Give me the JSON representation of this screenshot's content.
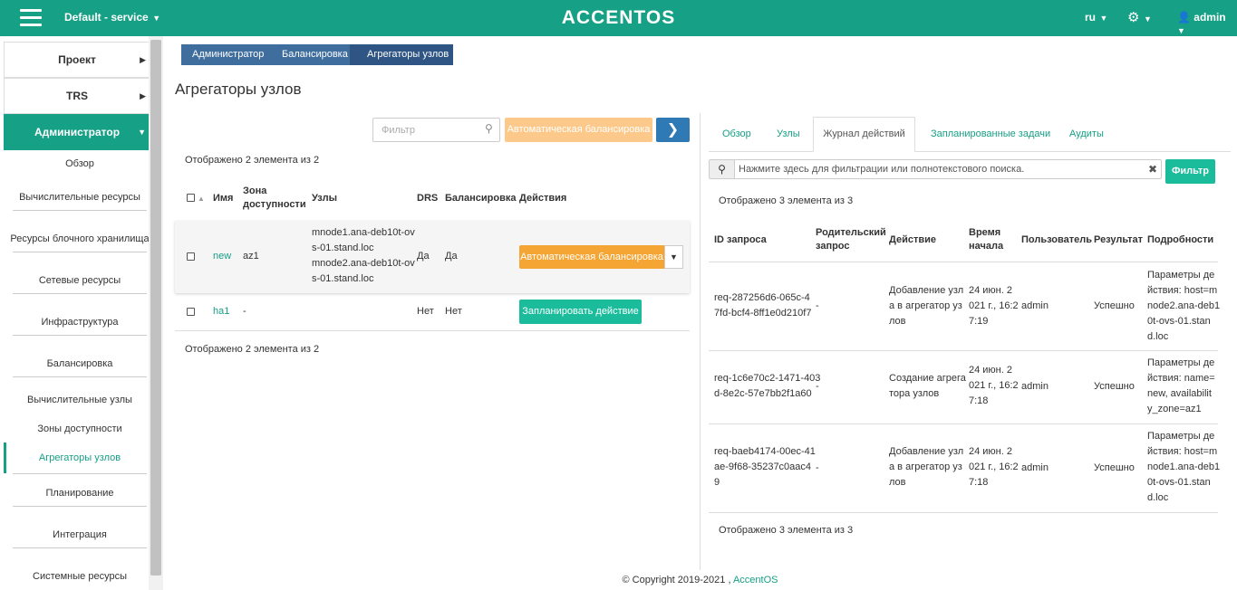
{
  "topbar": {
    "project": "Default - service",
    "logo": "ACCENTOS",
    "lang": "ru",
    "user": "admin",
    "bg": "#16a085"
  },
  "sidebar": {
    "top": [
      {
        "label": "Проект"
      },
      {
        "label": "TRS"
      },
      {
        "label": "Администратор"
      }
    ],
    "items": [
      "Обзор",
      "Вычислительные ресурсы",
      "Ресурсы блочного хранилища",
      "Сетевые ресурсы",
      "Инфраструктура",
      "Балансировка",
      "Вычислительные узлы",
      "Зоны доступности",
      "Агрегаторы узлов",
      "Планирование",
      "Интеграция",
      "Системные ресурсы"
    ]
  },
  "breadcrumb": [
    "Администратор",
    "Балансировка",
    "Агрегаторы узлов"
  ],
  "page_title": "Агрегаторы узлов",
  "left": {
    "filter_placeholder": "Фильтр",
    "auto_btn": "Автоматическая балансировка",
    "count": "Отображено 2 элемента из 2",
    "headers": {
      "name": "Имя",
      "zone_1": "Зона",
      "zone_2": "доступности",
      "nodes": "Узлы",
      "drs": "DRS",
      "balance": "Балансировка",
      "actions": "Действия"
    },
    "rows": [
      {
        "name": "new",
        "zone": "az1",
        "nodes": [
          "mnode1.ana-deb10t-ov",
          "s-01.stand.loc",
          "mnode2.ana-deb10t-ov",
          "s-01.stand.loc"
        ],
        "drs": "Да",
        "balance": "Да",
        "action": "Автоматическая балансировка"
      },
      {
        "name": "ha1",
        "zone": "-",
        "drs": "Нет",
        "balance": "Нет",
        "action": "Запланировать действие"
      }
    ]
  },
  "right": {
    "tabs": [
      "Обзор",
      "Узлы",
      "Журнал действий",
      "Запланированные задачи",
      "Аудиты"
    ],
    "search_placeholder": "Нажмите здесь для фильтрации или полнотекстового поиска.",
    "filter_btn": "Фильтр",
    "count": "Отображено 3 элемента из 3",
    "headers": {
      "req": "ID запроса",
      "parent_1": "Родительский",
      "parent_2": "запрос",
      "action": "Действие",
      "time_1": "Время",
      "time_2": "начала",
      "user": "Пользователь",
      "result": "Результат",
      "details": "Подробности"
    },
    "rows": [
      {
        "req": [
          "req-287256d6-065c-4",
          "7fd-bcf4-8ff1e0d210f7"
        ],
        "parent": "-",
        "action": [
          "Добавление узл",
          "а в агрегатор уз",
          "лов"
        ],
        "time": [
          "24 июн. 2",
          "021 г., 16:2",
          "7:19"
        ],
        "user": "admin",
        "result": "Успешно",
        "details": [
          "Параметры де",
          "йствия: host=m",
          "node2.ana-deb1",
          "0t-ovs-01.stan",
          "d.loc"
        ]
      },
      {
        "req": [
          "req-1c6e70c2-1471-403",
          "d-8e2c-57e7bb2f1a60"
        ],
        "parent": "-",
        "action": [
          "Создание агрега",
          "тора узлов"
        ],
        "time": [
          "24 июн. 2",
          "021 г., 16:2",
          "7:18"
        ],
        "user": "admin",
        "result": "Успешно",
        "details": [
          "Параметры де",
          "йствия: name=",
          "new, availabilit",
          "y_zone=az1"
        ]
      },
      {
        "req": [
          "req-baeb4174-00ec-41",
          "ae-9f68-35237c0aac4",
          "9"
        ],
        "parent": "-",
        "action": [
          "Добавление узл",
          "а в агрегатор уз",
          "лов"
        ],
        "time": [
          "24 июн. 2",
          "021 г., 16:2",
          "7:18"
        ],
        "user": "admin",
        "result": "Успешно",
        "details": [
          "Параметры де",
          "йствия: host=m",
          "node1.ana-deb1",
          "0t-ovs-01.stan",
          "d.loc"
        ]
      }
    ]
  },
  "footer": {
    "copyright": "© Copyright 2019-2021 ,",
    "link": "AccentOS"
  }
}
